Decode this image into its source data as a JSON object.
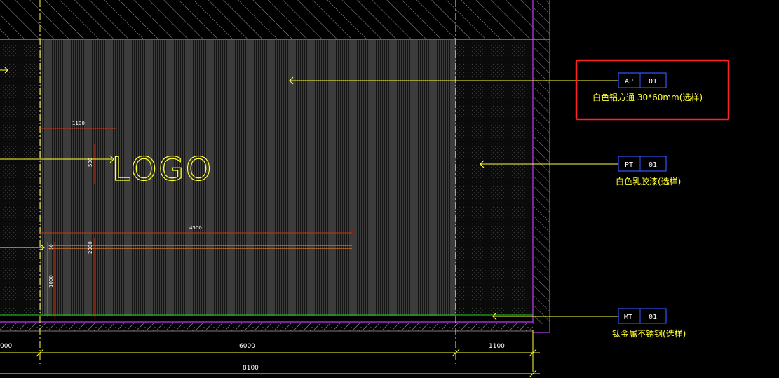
{
  "drawing": {
    "logo_text": "LOGO",
    "dims": {
      "logo_width": "1100",
      "logo_height": "500",
      "band_width": "4500",
      "band_height": "2000",
      "band_small": "30",
      "lower_height": "1000",
      "bottom_left": "000",
      "bottom_center": "6000",
      "bottom_right": "1100",
      "overall": "8100"
    },
    "tags": [
      {
        "code": "AP",
        "num": "01",
        "desc": "白色铝方通 30*60mm(选样)"
      },
      {
        "code": "PT",
        "num": "01",
        "desc": "白色乳胶漆(选样)"
      },
      {
        "code": "MT",
        "num": "01",
        "desc": "钛金属不锈钢(选样)"
      }
    ]
  },
  "colors": {
    "background": "#000000",
    "linework": "#ffff33",
    "wall_outline": "#9933cc",
    "green_line": "#22cc22",
    "tag_border": "#3355ff",
    "highlight_box": "#ff2222",
    "dim_line": "#cc3311",
    "hatch": "#9a9a9a"
  }
}
